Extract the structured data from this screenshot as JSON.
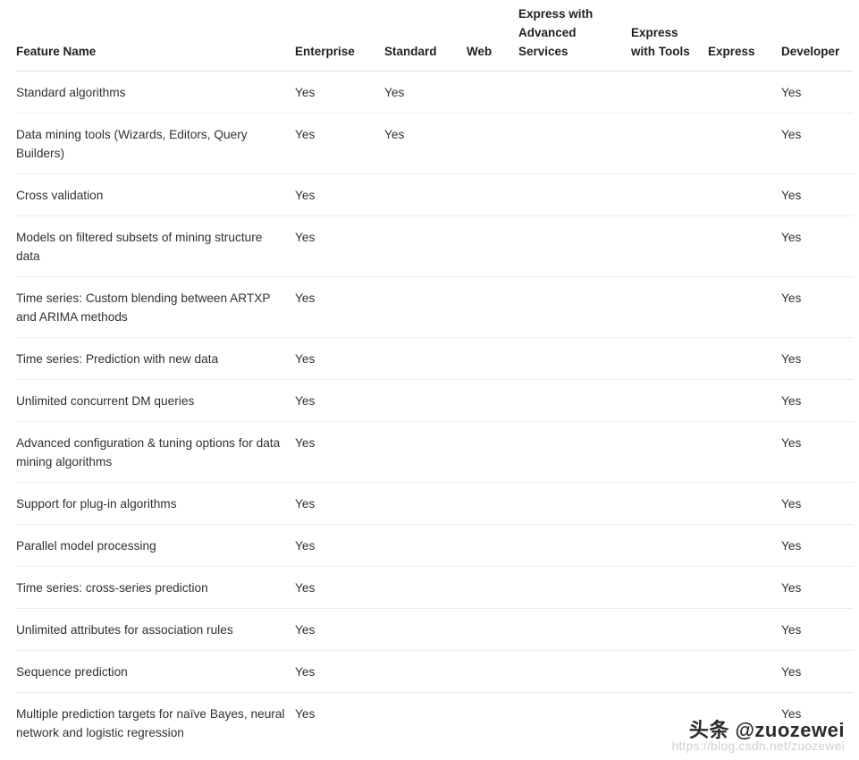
{
  "table": {
    "columns": [
      {
        "key": "feature",
        "label": "Feature Name"
      },
      {
        "key": "enterprise",
        "label": "Enterprise"
      },
      {
        "key": "standard",
        "label": "Standard"
      },
      {
        "key": "web",
        "label": "Web"
      },
      {
        "key": "express_advanced_services",
        "label": "Express with Advanced Services"
      },
      {
        "key": "express_with_tools",
        "label": "Express with Tools"
      },
      {
        "key": "express",
        "label": "Express"
      },
      {
        "key": "developer",
        "label": "Developer"
      }
    ],
    "rows": [
      {
        "feature": "Standard algorithms",
        "enterprise": "Yes",
        "standard": "Yes",
        "web": "",
        "express_advanced_services": "",
        "express_with_tools": "",
        "express": "",
        "developer": "Yes"
      },
      {
        "feature": "Data mining tools (Wizards, Editors, Query Builders)",
        "enterprise": "Yes",
        "standard": "Yes",
        "web": "",
        "express_advanced_services": "",
        "express_with_tools": "",
        "express": "",
        "developer": "Yes"
      },
      {
        "feature": "Cross validation",
        "enterprise": "Yes",
        "standard": "",
        "web": "",
        "express_advanced_services": "",
        "express_with_tools": "",
        "express": "",
        "developer": "Yes"
      },
      {
        "feature": "Models on filtered subsets of mining structure data",
        "enterprise": "Yes",
        "standard": "",
        "web": "",
        "express_advanced_services": "",
        "express_with_tools": "",
        "express": "",
        "developer": "Yes"
      },
      {
        "feature": "Time series: Custom blending between ARTXP and ARIMA methods",
        "enterprise": "Yes",
        "standard": "",
        "web": "",
        "express_advanced_services": "",
        "express_with_tools": "",
        "express": "",
        "developer": "Yes"
      },
      {
        "feature": "Time series: Prediction with new data",
        "enterprise": "Yes",
        "standard": "",
        "web": "",
        "express_advanced_services": "",
        "express_with_tools": "",
        "express": "",
        "developer": "Yes"
      },
      {
        "feature": "Unlimited concurrent DM queries",
        "enterprise": "Yes",
        "standard": "",
        "web": "",
        "express_advanced_services": "",
        "express_with_tools": "",
        "express": "",
        "developer": "Yes"
      },
      {
        "feature": "Advanced configuration & tuning options for data mining algorithms",
        "enterprise": "Yes",
        "standard": "",
        "web": "",
        "express_advanced_services": "",
        "express_with_tools": "",
        "express": "",
        "developer": "Yes"
      },
      {
        "feature": "Support for plug-in algorithms",
        "enterprise": "Yes",
        "standard": "",
        "web": "",
        "express_advanced_services": "",
        "express_with_tools": "",
        "express": "",
        "developer": "Yes"
      },
      {
        "feature": "Parallel model processing",
        "enterprise": "Yes",
        "standard": "",
        "web": "",
        "express_advanced_services": "",
        "express_with_tools": "",
        "express": "",
        "developer": "Yes"
      },
      {
        "feature": "Time series: cross-series prediction",
        "enterprise": "Yes",
        "standard": "",
        "web": "",
        "express_advanced_services": "",
        "express_with_tools": "",
        "express": "",
        "developer": "Yes"
      },
      {
        "feature": "Unlimited attributes for association rules",
        "enterprise": "Yes",
        "standard": "",
        "web": "",
        "express_advanced_services": "",
        "express_with_tools": "",
        "express": "",
        "developer": "Yes"
      },
      {
        "feature": "Sequence prediction",
        "enterprise": "Yes",
        "standard": "",
        "web": "",
        "express_advanced_services": "",
        "express_with_tools": "",
        "express": "",
        "developer": "Yes"
      },
      {
        "feature": "Multiple prediction targets for naïve Bayes, neural network and logistic regression",
        "enterprise": "Yes",
        "standard": "",
        "web": "",
        "express_advanced_services": "",
        "express_with_tools": "",
        "express": "",
        "developer": "Yes"
      }
    ]
  },
  "watermark": {
    "main": "头条 @zuozewei",
    "url": "https://blog.csdn.net/zuozewei"
  },
  "colors": {
    "text": "#323130",
    "heading": "#201f1e",
    "row_divider": "#edebe9",
    "header_divider": "#e1dfdd",
    "background": "#ffffff",
    "watermark_url": "#cfcfcf"
  }
}
